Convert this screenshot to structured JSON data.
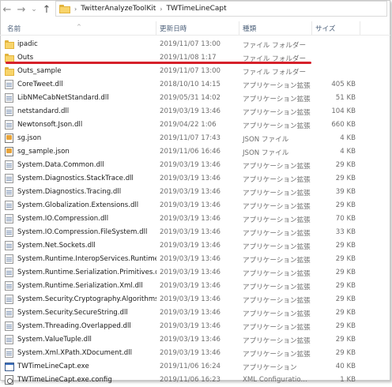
{
  "nav": {
    "back": "←",
    "forward": "→",
    "dropdown": "⌄",
    "up": "↑"
  },
  "breadcrumb": {
    "sep": "›",
    "items": [
      "TwitterAnalyzeToolKit",
      "TWTimeLineCapt"
    ]
  },
  "columns": {
    "name": "名前",
    "date": "更新日時",
    "type": "種類",
    "size": "サイズ",
    "sort_indicator": "^"
  },
  "colors": {
    "annotation_underline": "#d6202a",
    "folder": "#f8d46a"
  },
  "files": [
    {
      "icon": "folder-icon",
      "name": "ipadic",
      "date": "2019/11/07 13:00",
      "type": "ファイル フォルダー",
      "size": ""
    },
    {
      "icon": "folder-icon",
      "name": "Outs",
      "date": "2019/11/08 1:17",
      "type": "ファイル フォルダー",
      "size": ""
    },
    {
      "icon": "folder-icon",
      "name": "Outs_sample",
      "date": "2019/11/07 13:00",
      "type": "ファイル フォルダー",
      "size": ""
    },
    {
      "icon": "dll-icon",
      "name": "CoreTweet.dll",
      "date": "2018/10/10 14:15",
      "type": "アプリケーション拡張",
      "size": "405 KB"
    },
    {
      "icon": "dll-icon",
      "name": "LibNMeCabNetStandard.dll",
      "date": "2019/05/31 14:02",
      "type": "アプリケーション拡張",
      "size": "51 KB"
    },
    {
      "icon": "dll-icon",
      "name": "netstandard.dll",
      "date": "2019/03/19 13:46",
      "type": "アプリケーション拡張",
      "size": "104 KB"
    },
    {
      "icon": "dll-icon",
      "name": "Newtonsoft.Json.dll",
      "date": "2019/04/22 1:06",
      "type": "アプリケーション拡張",
      "size": "660 KB"
    },
    {
      "icon": "json-icon",
      "name": "sg.json",
      "date": "2019/11/07 17:43",
      "type": "JSON ファイル",
      "size": "4 KB"
    },
    {
      "icon": "json-icon",
      "name": "sg_sample.json",
      "date": "2019/11/06 16:46",
      "type": "JSON ファイル",
      "size": "4 KB"
    },
    {
      "icon": "dll-icon",
      "name": "System.Data.Common.dll",
      "date": "2019/03/19 13:46",
      "type": "アプリケーション拡張",
      "size": "29 KB"
    },
    {
      "icon": "dll-icon",
      "name": "System.Diagnostics.StackTrace.dll",
      "date": "2019/03/19 13:46",
      "type": "アプリケーション拡張",
      "size": "29 KB"
    },
    {
      "icon": "dll-icon",
      "name": "System.Diagnostics.Tracing.dll",
      "date": "2019/03/19 13:46",
      "type": "アプリケーション拡張",
      "size": "39 KB"
    },
    {
      "icon": "dll-icon",
      "name": "System.Globalization.Extensions.dll",
      "date": "2019/03/19 13:46",
      "type": "アプリケーション拡張",
      "size": "29 KB"
    },
    {
      "icon": "dll-icon",
      "name": "System.IO.Compression.dll",
      "date": "2019/03/19 13:46",
      "type": "アプリケーション拡張",
      "size": "70 KB"
    },
    {
      "icon": "dll-icon",
      "name": "System.IO.Compression.FileSystem.dll",
      "date": "2019/03/19 13:46",
      "type": "アプリケーション拡張",
      "size": "33 KB"
    },
    {
      "icon": "dll-icon",
      "name": "System.Net.Sockets.dll",
      "date": "2019/03/19 13:46",
      "type": "アプリケーション拡張",
      "size": "29 KB"
    },
    {
      "icon": "dll-icon",
      "name": "System.Runtime.InteropServices.Runtimel...",
      "date": "2019/03/19 13:46",
      "type": "アプリケーション拡張",
      "size": "29 KB"
    },
    {
      "icon": "dll-icon",
      "name": "System.Runtime.Serialization.Primitives.dll",
      "date": "2019/03/19 13:46",
      "type": "アプリケーション拡張",
      "size": "29 KB"
    },
    {
      "icon": "dll-icon",
      "name": "System.Runtime.Serialization.Xml.dll",
      "date": "2019/03/19 13:46",
      "type": "アプリケーション拡張",
      "size": "29 KB"
    },
    {
      "icon": "dll-icon",
      "name": "System.Security.Cryptography.Algorithms...",
      "date": "2019/03/19 13:46",
      "type": "アプリケーション拡張",
      "size": "29 KB"
    },
    {
      "icon": "dll-icon",
      "name": "System.Security.SecureString.dll",
      "date": "2019/03/19 13:46",
      "type": "アプリケーション拡張",
      "size": "29 KB"
    },
    {
      "icon": "dll-icon",
      "name": "System.Threading.Overlapped.dll",
      "date": "2019/03/19 13:46",
      "type": "アプリケーション拡張",
      "size": "29 KB"
    },
    {
      "icon": "dll-icon",
      "name": "System.ValueTuple.dll",
      "date": "2019/03/19 13:46",
      "type": "アプリケーション拡張",
      "size": "29 KB"
    },
    {
      "icon": "dll-icon",
      "name": "System.Xml.XPath.XDocument.dll",
      "date": "2019/03/19 13:46",
      "type": "アプリケーション拡張",
      "size": "29 KB"
    },
    {
      "icon": "exe-icon",
      "name": "TWTimeLineCapt.exe",
      "date": "2019/11/06 16:24",
      "type": "アプリケーション",
      "size": "40 KB"
    },
    {
      "icon": "config-icon",
      "name": "TWTimeLineCapt.exe.config",
      "date": "2019/11/06 16:23",
      "type": "XML Configuratio...",
      "size": "1 KB"
    }
  ]
}
